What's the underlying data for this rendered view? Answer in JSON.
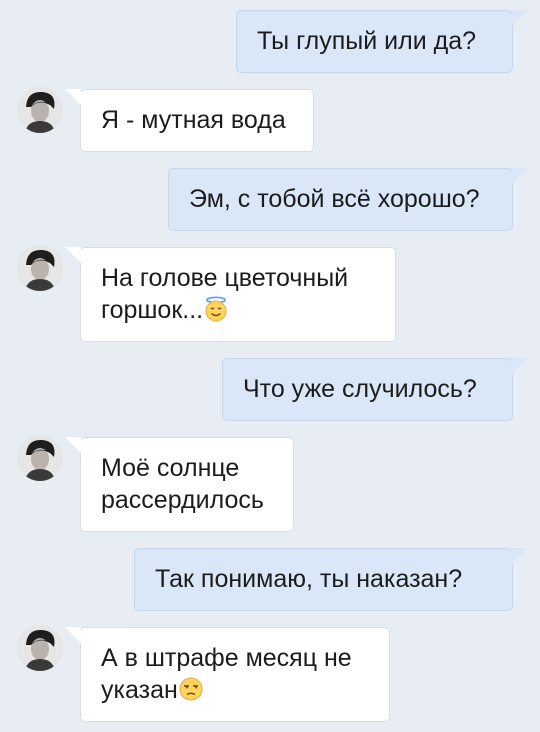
{
  "conversation": {
    "messages": [
      {
        "side": "out",
        "text": "Ты глупый или да?"
      },
      {
        "side": "in",
        "text": "Я - мутная вода"
      },
      {
        "side": "out",
        "text": "Эм, с тобой всё хорошо?"
      },
      {
        "side": "in",
        "text_line1": "На голове цветочный",
        "text_line2": "горшок...",
        "emoji": "smiling-face-with-halo"
      },
      {
        "side": "out",
        "text": "Что уже случилось?"
      },
      {
        "side": "in",
        "text_line1": "Моё солнце",
        "text_line2": "рассердилось"
      },
      {
        "side": "out",
        "text": "Так понимаю, ты наказан?"
      },
      {
        "side": "in",
        "text_line1": "А в штрафе месяц не",
        "text_line2": "указан",
        "emoji": "unamused-face"
      }
    ]
  },
  "colors": {
    "background": "#e8edf3",
    "outgoing_bubble": "#d9e7f8",
    "incoming_bubble": "#ffffff",
    "text": "#1c1c1c"
  }
}
